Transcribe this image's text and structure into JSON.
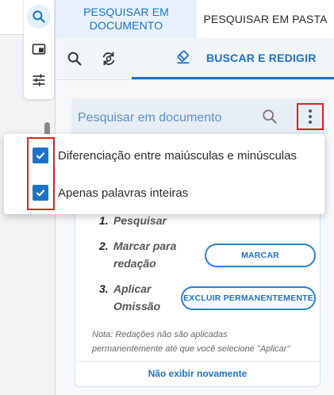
{
  "tabs": [
    {
      "label": "PESQUISAR EM DOCUMENTO",
      "active": true
    },
    {
      "label": "PESQUISAR EM PASTA",
      "active": false
    }
  ],
  "toolbar_left": {
    "icons": [
      "search-icon",
      "panel-icon",
      "sliders-icon"
    ]
  },
  "subtoolbar": {
    "redact_tab_label": "BUSCAR E REDIGIR"
  },
  "search": {
    "placeholder": "Pesquisar em documento"
  },
  "menu": {
    "items": [
      {
        "label": "Diferenciação entre maiúsculas e minúsculas",
        "checked": true
      },
      {
        "label": "Apenas palavras inteiras",
        "checked": true
      }
    ]
  },
  "guide": {
    "steps": [
      {
        "number": "1.",
        "line1": "Pesquisar",
        "line2": ""
      },
      {
        "number": "2.",
        "line1": "Marcar para",
        "line2": "redação"
      },
      {
        "number": "3.",
        "line1": "Aplicar",
        "line2": "Omissão"
      }
    ],
    "mark_button": "MARCAR",
    "delete_button": "EXCLUIR PERMANENTEMENTE",
    "note_line1": "Nota: Redações não são aplicadas",
    "note_line2": "permanentemente até que você selecione \"Aplicar\"",
    "dont_show_again": "Não exibir novamente"
  },
  "colors": {
    "accent": "#1a73c8",
    "highlight_box": "#e02020",
    "active_tab_bg": "#e8f1fb"
  }
}
